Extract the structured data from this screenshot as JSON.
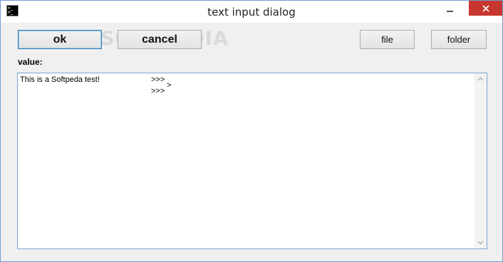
{
  "window": {
    "title": "text input dialog",
    "icon": "terminal-icon",
    "icon_glyph_line1": ">_",
    "icon_glyph_line2": ">_"
  },
  "toolbar": {
    "ok_label": "ok",
    "cancel_label": "cancel",
    "file_label": "file",
    "folder_label": "folder"
  },
  "watermark": "SOFTPEDIA",
  "form": {
    "value_label": "value:",
    "text_line1": "This is a Softpeda test!",
    "prompt_line1": ">>>",
    "prompt_line2": ">",
    "prompt_line3": ">>>"
  },
  "colors": {
    "close_button": "#c7372f",
    "window_border": "#6d9fd1",
    "background": "#f0f0f0"
  }
}
